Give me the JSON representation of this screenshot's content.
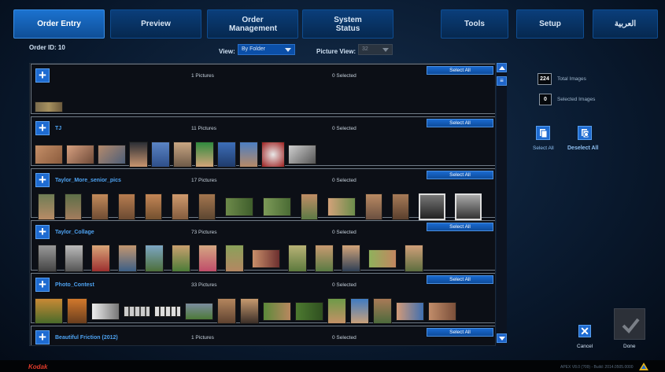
{
  "nav": {
    "tabs": [
      {
        "label": "Order Entry",
        "active": true
      },
      {
        "label": "Preview"
      },
      {
        "label": "Order Management"
      },
      {
        "label": "System Status"
      },
      {
        "label": "Tools"
      },
      {
        "label": "Setup"
      },
      {
        "label": "العربية"
      }
    ]
  },
  "order": {
    "id_label": "Order ID: 10"
  },
  "view": {
    "label": "View:",
    "value": "By Folder"
  },
  "picture_view": {
    "label": "Picture View:",
    "value": "32"
  },
  "folders": [
    {
      "name": "",
      "count": "1 Pictures",
      "selected": "0 Selected",
      "select_all": "Select All"
    },
    {
      "name": "TJ",
      "count": "11 Pictures",
      "selected": "0 Selected",
      "select_all": "Select All"
    },
    {
      "name": "Taylor_More_senior_pics",
      "count": "17 Pictures",
      "selected": "0 Selected",
      "select_all": "Select All"
    },
    {
      "name": "Taylor_Collage",
      "count": "73 Pictures",
      "selected": "0 Selected",
      "select_all": "Select All"
    },
    {
      "name": "Photo_Contest",
      "count": "33 Pictures",
      "selected": "0 Selected",
      "select_all": "Select All"
    },
    {
      "name": "Beautiful Friction (2012)",
      "count": "1 Pictures",
      "selected": "0 Selected",
      "select_all": "Select All"
    }
  ],
  "summary": {
    "total_images": "224",
    "total_label": "Total Images",
    "selected_images": "0",
    "selected_label": "Selected Images"
  },
  "actions": {
    "select_all": "Select All",
    "deselect_all": "Deselect All",
    "cancel": "Cancel",
    "done": "Done"
  },
  "footer": {
    "brand": "Kodak",
    "version": "APEX V8.0 (?09) - Build: 2014.0505.0000"
  },
  "colors": {
    "accent": "#1e6bd1",
    "link": "#4ea3f2",
    "brand": "#e23b2a"
  }
}
